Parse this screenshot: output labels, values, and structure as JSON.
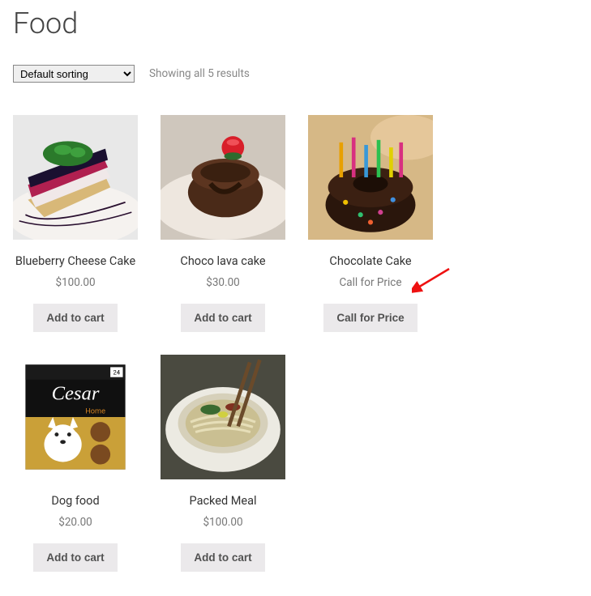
{
  "page_title": "Food",
  "sort_options": [
    "Default sorting"
  ],
  "sort_selected": "Default sorting",
  "result_count": "Showing all 5 results",
  "products": [
    {
      "title": "Blueberry Cheese Cake",
      "price": "$100.00",
      "button": "Add to cart"
    },
    {
      "title": "Choco lava cake",
      "price": "$30.00",
      "button": "Add to cart"
    },
    {
      "title": "Chocolate Cake",
      "price": "Call for Price",
      "button": "Call for Price"
    },
    {
      "title": "Dog food",
      "price": "$20.00",
      "button": "Add to cart"
    },
    {
      "title": "Packed Meal",
      "price": "$100.00",
      "button": "Add to cart"
    }
  ],
  "annotation": {
    "arrow_target": "product-2-price"
  }
}
